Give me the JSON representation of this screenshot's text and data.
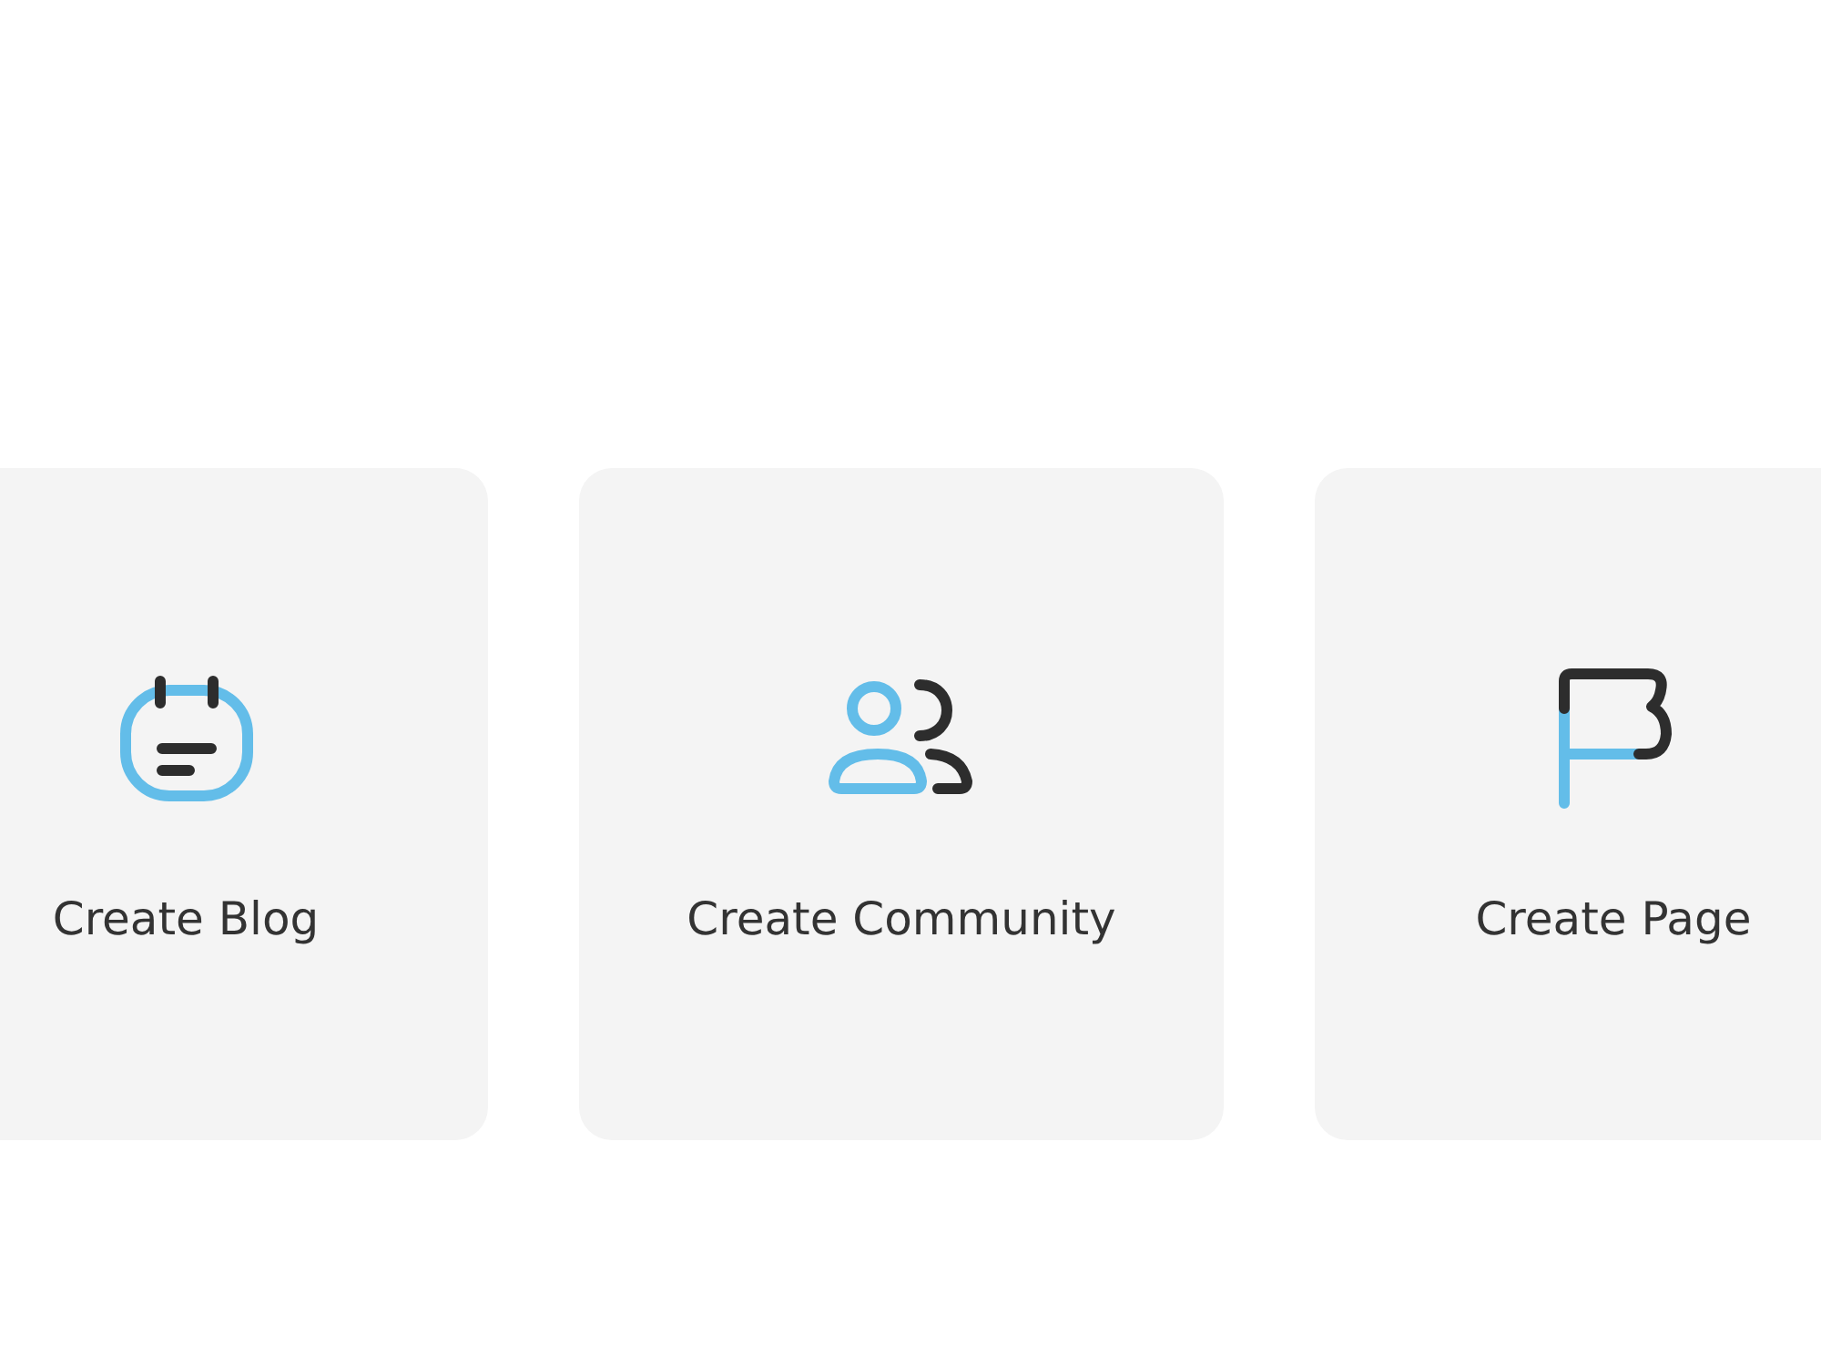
{
  "cards": [
    {
      "kind": "blog",
      "label": "Create Blog"
    },
    {
      "kind": "community",
      "label": "Create Community"
    },
    {
      "kind": "page",
      "label": "Create Page"
    }
  ]
}
